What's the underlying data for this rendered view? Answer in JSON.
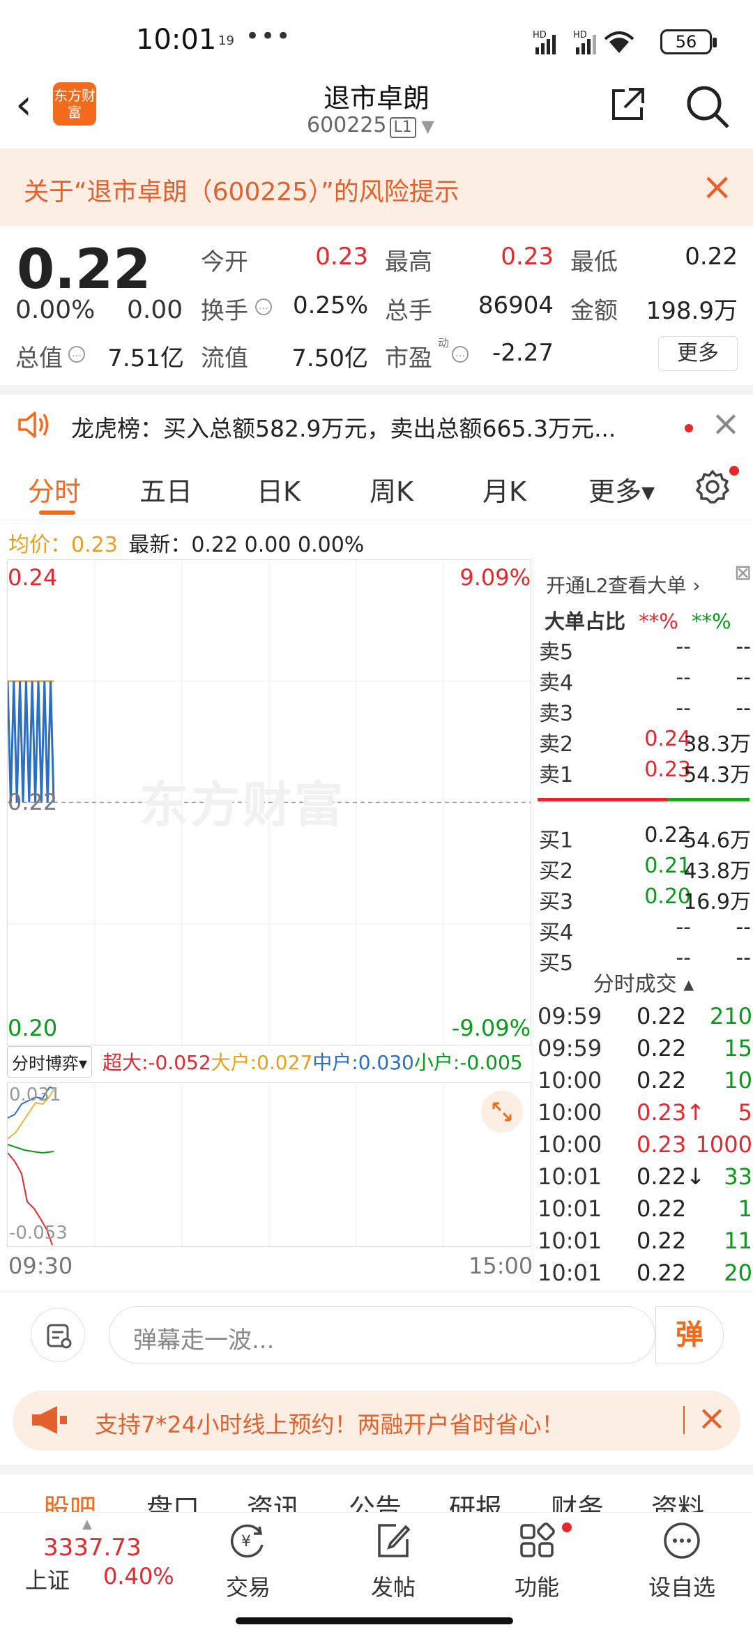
{
  "status_bar": {
    "time": "10:01",
    "time_sup": "19",
    "dots": "•••",
    "battery": "56"
  },
  "header": {
    "logo_text": "东方财富",
    "stock_name": "退市卓朗",
    "stock_code": "600225",
    "level": "L1"
  },
  "risk_banner": {
    "text": "关于“退市卓朗（600225）”的风险提示"
  },
  "quote": {
    "price": "0.22",
    "pct": "0.00%",
    "change": "0.00",
    "items": [
      {
        "label": "今开",
        "value": "0.23",
        "color": "#e4282d"
      },
      {
        "label": "最高",
        "value": "0.23",
        "color": "#e4282d"
      },
      {
        "label": "最低",
        "value": "0.22",
        "color": "#222222"
      },
      {
        "label": "换手",
        "value": "0.25%",
        "color": "#222222"
      },
      {
        "label": "总手",
        "value": "86904",
        "color": "#222222"
      },
      {
        "label": "金额",
        "value": "198.9万",
        "color": "#222222"
      },
      {
        "label": "总值",
        "value": "7.51亿",
        "color": "#222222"
      },
      {
        "label": "流值",
        "value": "7.50亿",
        "color": "#222222"
      },
      {
        "label": "市盈",
        "value": "-2.27",
        "color": "#222222"
      }
    ],
    "pe_sup": "动",
    "more": "更多"
  },
  "dragon_tiger": {
    "text": "龙虎榜：买入总额582.9万元，卖出总额665.3万元..."
  },
  "tabs": [
    "分时",
    "五日",
    "日K",
    "周K",
    "月K",
    "更多▾"
  ],
  "info_line": {
    "avg_label": "均价：",
    "avg_value": "0.23",
    "latest": "最新：0.22  0.00  0.00%"
  },
  "chart": {
    "y_top": "0.24",
    "y_mid": "0.22",
    "y_bottom": "0.20",
    "pct_top": "9.09%",
    "pct_bottom": "-9.09%",
    "watermark": "东方财富",
    "time_start": "09:30",
    "time_end": "15:00"
  },
  "chart_data": {
    "type": "line",
    "title": "",
    "ylim": [
      0.2,
      0.24
    ],
    "y_reference": 0.22,
    "series": [
      {
        "values": [
          0.23,
          0.22,
          0.23,
          0.22,
          0.23,
          0.22,
          0.23,
          0.22,
          0.23,
          0.22,
          0.23,
          0.22,
          0.23,
          0.22,
          0.23,
          0.22
        ],
        "color": "#2a6fc4"
      },
      {
        "values": [
          0.23,
          0.23,
          0.23,
          0.23,
          0.23,
          0.23,
          0.23,
          0.23,
          0.23,
          0.23,
          0.23,
          0.23,
          0.23,
          0.23,
          0.23,
          0.23
        ],
        "color": "#e8b43a"
      }
    ]
  },
  "capital_flow": {
    "selector": "分时博弈▾",
    "items": [
      {
        "label": "超大:",
        "value": "-0.052",
        "color": "#e4282d"
      },
      {
        "label": "大户:",
        "value": "0.027",
        "color": "#e8a01a"
      },
      {
        "label": "中户:",
        "value": "0.030",
        "color": "#2a6fc4"
      },
      {
        "label": "小户:",
        "value": "-0.005",
        "color": "#0a9a1a"
      }
    ],
    "y_top": "0.031",
    "y_bottom": "-0.053"
  },
  "order_book": {
    "l2_link": "开通L2查看大单 ›",
    "big_ratio_label": "大单占比",
    "big_ratio_buy": "**%",
    "big_ratio_sell": "**%",
    "asks": [
      {
        "name": "卖5",
        "price": "--",
        "vol": "--",
        "color": "#333333"
      },
      {
        "name": "卖4",
        "price": "--",
        "vol": "--",
        "color": "#333333"
      },
      {
        "name": "卖3",
        "price": "--",
        "vol": "--",
        "color": "#333333"
      },
      {
        "name": "卖2",
        "price": "0.24",
        "vol": "38.3万",
        "color": "#e4282d"
      },
      {
        "name": "卖1",
        "price": "0.23",
        "vol": "54.3万",
        "color": "#e4282d"
      }
    ],
    "bids": [
      {
        "name": "买1",
        "price": "0.22",
        "vol": "54.6万",
        "color": "#222222"
      },
      {
        "name": "买2",
        "price": "0.21",
        "vol": "43.8万",
        "color": "#0a9a1a"
      },
      {
        "name": "买3",
        "price": "0.20",
        "vol": "16.9万",
        "color": "#0a9a1a"
      },
      {
        "name": "买4",
        "price": "--",
        "vol": "--",
        "color": "#333333"
      },
      {
        "name": "买5",
        "price": "--",
        "vol": "--",
        "color": "#333333"
      }
    ],
    "trades_title": "分时成交 ▴",
    "trades": [
      {
        "time": "09:59",
        "price": "0.22",
        "vol": "210",
        "pcolor": "#222222",
        "vcolor": "#0a9a1a"
      },
      {
        "time": "09:59",
        "price": "0.22",
        "vol": "15",
        "pcolor": "#222222",
        "vcolor": "#0a9a1a"
      },
      {
        "time": "10:00",
        "price": "0.22",
        "vol": "10",
        "pcolor": "#222222",
        "vcolor": "#0a9a1a"
      },
      {
        "time": "10:00",
        "price": "0.23↑",
        "vol": "5",
        "pcolor": "#e4282d",
        "vcolor": "#e4282d"
      },
      {
        "time": "10:00",
        "price": "0.23",
        "vol": "1000",
        "pcolor": "#e4282d",
        "vcolor": "#e4282d"
      },
      {
        "time": "10:01",
        "price": "0.22↓",
        "vol": "33",
        "pcolor": "#222222",
        "vcolor": "#0a9a1a"
      },
      {
        "time": "10:01",
        "price": "0.22",
        "vol": "1",
        "pcolor": "#222222",
        "vcolor": "#0a9a1a"
      },
      {
        "time": "10:01",
        "price": "0.22",
        "vol": "11",
        "pcolor": "#222222",
        "vcolor": "#0a9a1a"
      },
      {
        "time": "10:01",
        "price": "0.22",
        "vol": "20",
        "pcolor": "#222222",
        "vcolor": "#0a9a1a"
      }
    ]
  },
  "danmu": {
    "placeholder": "弹幕走一波...",
    "button": "弹"
  },
  "promo": {
    "text": "支持7*24小时线上预约！两融开户省时省心！"
  },
  "bottom_tabs": [
    "股吧",
    "盘口",
    "资讯",
    "公告",
    "研报",
    "财务",
    "资料"
  ],
  "bottom_nav": {
    "index_value": "3337.73",
    "index_name": "上证",
    "index_pct": "0.40%",
    "items": [
      {
        "label": "交易",
        "icon": "trade-icon"
      },
      {
        "label": "发帖",
        "icon": "post-icon"
      },
      {
        "label": "功能",
        "icon": "function-icon"
      },
      {
        "label": "设自选",
        "icon": "add-watchlist-icon"
      }
    ]
  }
}
